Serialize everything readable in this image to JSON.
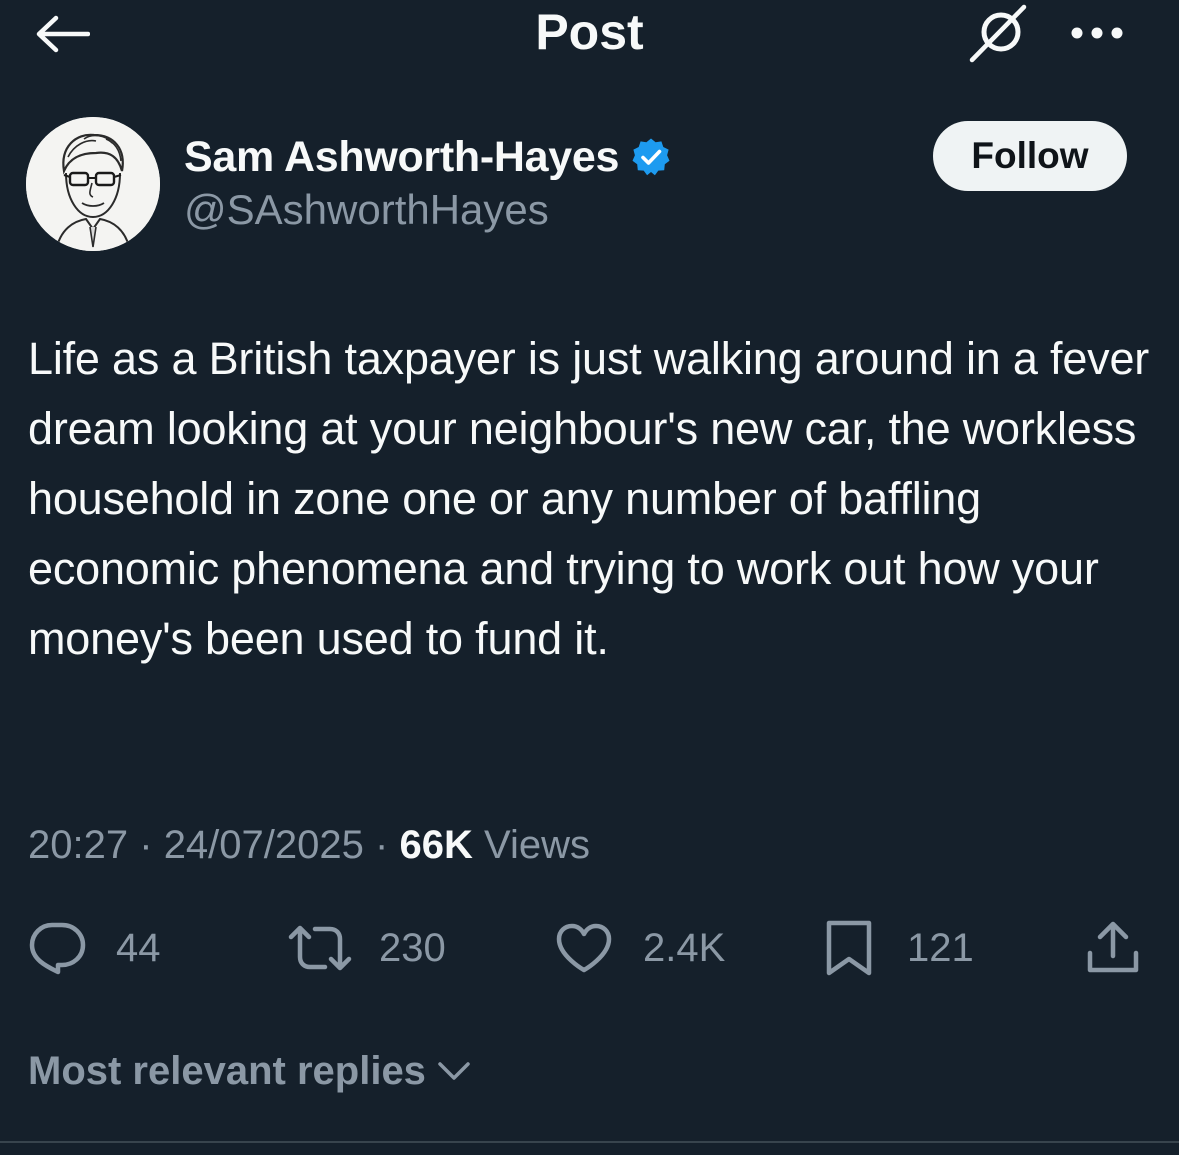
{
  "header": {
    "title": "Post",
    "back_icon": "arrow-left-icon",
    "grok_icon": "grok-icon",
    "more_icon": "more-horizontal-icon"
  },
  "author": {
    "name": "Sam Ashworth-Hayes",
    "handle": "@SAshworthHayes",
    "verified_icon": "verified-badge-icon",
    "avatar": "caricature-avatar",
    "follow_label": "Follow"
  },
  "post": {
    "text": "Life as a British taxpayer is just walking around in a fever dream looking at your neighbour's new car, the workless household in zone one or any number of baffling economic phenomena and trying to work out how your money's been used to fund it.",
    "time": "20:27",
    "separator": "·",
    "date": "24/07/2025",
    "views_count": "66K",
    "views_label": "Views"
  },
  "actions": {
    "replies": {
      "icon": "reply-icon",
      "count": "44"
    },
    "reposts": {
      "icon": "repost-icon",
      "count": "230"
    },
    "likes": {
      "icon": "heart-icon",
      "count": "2.4K"
    },
    "bookmarks": {
      "icon": "bookmark-icon",
      "count": "121"
    },
    "share": {
      "icon": "share-icon"
    }
  },
  "replies_sort": {
    "label": "Most relevant replies",
    "icon": "chevron-down-icon"
  },
  "colors": {
    "background": "#15202b",
    "primary_text": "#f7f9f9",
    "secondary_text": "#8b98a5",
    "verified_blue": "#1d9bf0",
    "follow_button_bg": "#eff3f4",
    "divider": "#38444d"
  }
}
